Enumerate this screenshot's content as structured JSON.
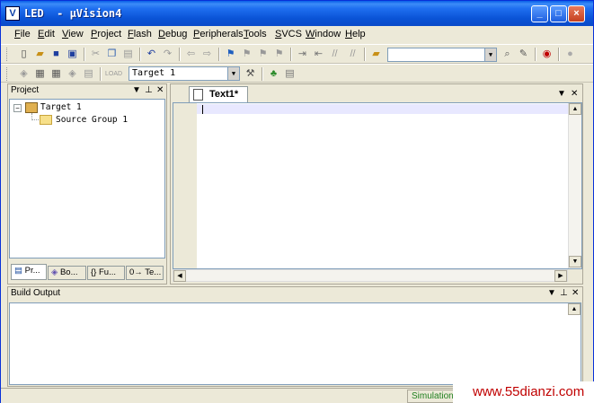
{
  "window": {
    "title": "LED  - μVision4",
    "minimize": "_",
    "maximize": "□",
    "close": "×"
  },
  "menu": [
    "File",
    "Edit",
    "View",
    "Project",
    "Flash",
    "Debug",
    "Peripherals",
    "Tools",
    "SVCS",
    "Window",
    "Help"
  ],
  "toolbar2": {
    "target_value": "Target 1"
  },
  "project_panel": {
    "title": "Project",
    "tree": {
      "target": "Target 1",
      "group": "Source Group 1"
    },
    "tabs": [
      "Pr...",
      "Bo...",
      "{} Fu...",
      "0→ Te..."
    ]
  },
  "editor": {
    "tab_label": "Text1*"
  },
  "build_output": {
    "title": "Build Output"
  },
  "status": {
    "mode": "Simulation"
  },
  "watermark": "www.55dianzi.com"
}
